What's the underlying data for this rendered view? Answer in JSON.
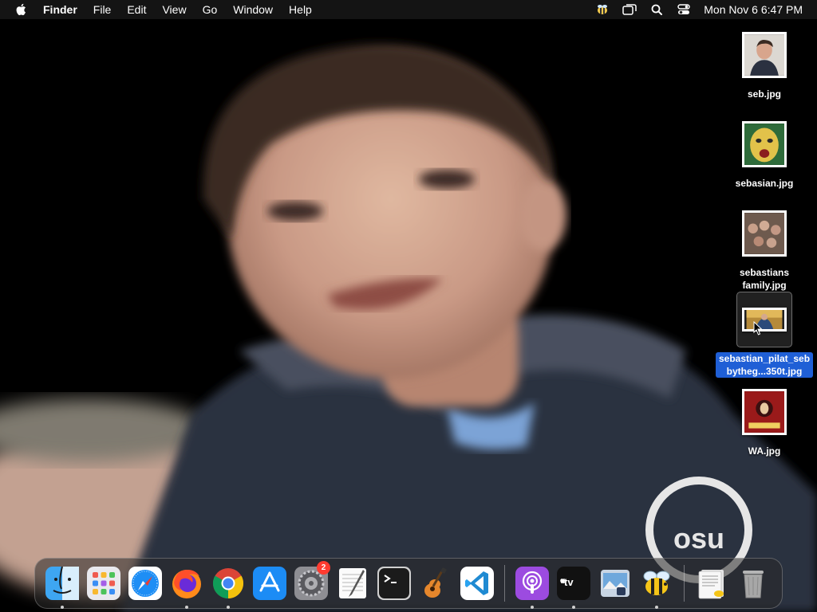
{
  "menubar": {
    "app_name": "Finder",
    "items": [
      "File",
      "Edit",
      "View",
      "Go",
      "Window",
      "Help"
    ],
    "status_icons": [
      "bee-icon",
      "screen-mirroring-icon",
      "search-icon",
      "control-center-icon"
    ],
    "clock": "Mon Nov 6  6:47 PM"
  },
  "desktop": {
    "files": [
      {
        "name": "seb.jpg",
        "selected": false
      },
      {
        "name": "sebasian.jpg",
        "selected": false
      },
      {
        "name": "sebastians family.jpg",
        "selected": false
      },
      {
        "name": "sebastian_pilat_sebbytheg...350t.jpg",
        "selected": true
      },
      {
        "name": "WA.jpg",
        "selected": false
      }
    ]
  },
  "dock": {
    "apps": [
      {
        "name": "Finder",
        "icon": "finder-icon",
        "running": true
      },
      {
        "name": "Launchpad",
        "icon": "launchpad-icon",
        "running": false
      },
      {
        "name": "Safari",
        "icon": "safari-icon",
        "running": false
      },
      {
        "name": "Firefox",
        "icon": "firefox-icon",
        "running": true
      },
      {
        "name": "Google Chrome",
        "icon": "chrome-icon",
        "running": true
      },
      {
        "name": "App Store",
        "icon": "app-store-icon",
        "running": false
      },
      {
        "name": "System Settings",
        "icon": "system-settings-icon",
        "running": false,
        "badge": "2"
      },
      {
        "name": "TextEdit",
        "icon": "textedit-icon",
        "running": false
      },
      {
        "name": "Terminal",
        "icon": "terminal-icon",
        "running": false
      },
      {
        "name": "GarageBand",
        "icon": "garageband-icon",
        "running": false
      },
      {
        "name": "Visual Studio Code",
        "icon": "vscode-icon",
        "running": false
      },
      {
        "name": "Podcasts",
        "icon": "podcasts-icon",
        "running": true
      },
      {
        "name": "Apple TV",
        "icon": "apple-tv-icon",
        "running": true,
        "label": "tv"
      },
      {
        "name": "Preview",
        "icon": "preview-icon",
        "running": false
      },
      {
        "name": "Bee",
        "icon": "bee-app-icon",
        "running": true
      },
      {
        "name": "Downloads",
        "icon": "downloads-stack-icon",
        "running": false
      },
      {
        "name": "Trash",
        "icon": "trash-icon",
        "running": false
      }
    ]
  },
  "colors": {
    "menubar_bg": "#161616",
    "selection_blue": "#1f5fd6",
    "badge_red": "#ff3b30",
    "hoodie_navy": "#2b3140"
  }
}
